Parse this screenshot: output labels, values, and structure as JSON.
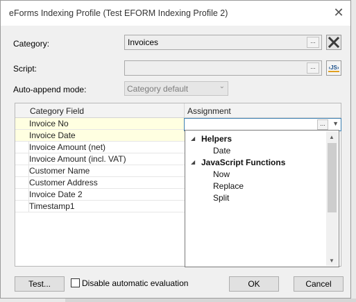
{
  "window": {
    "title": "eForms Indexing Profile (Test EFORM Indexing Profile 2)"
  },
  "form": {
    "category_label": "Category:",
    "category_value": "Invoices",
    "script_label": "Script:",
    "script_value": "",
    "ellipsis": "...",
    "js_icon_text": "‹JS›",
    "auto_append_label": "Auto-append mode:",
    "auto_append_value": "Category default"
  },
  "grid": {
    "columns": [
      "Category Field",
      "Assignment"
    ],
    "rows": [
      "Invoice No",
      "Invoice Date",
      "Invoice Amount (net)",
      "Invoice Amount (incl. VAT)",
      "Customer Name",
      "Customer Address",
      "Invoice Date 2",
      "Timestamp1"
    ],
    "highlighted_rows": [
      0,
      1
    ]
  },
  "popup": {
    "groups": [
      {
        "label": "Helpers",
        "items": [
          "Date"
        ]
      },
      {
        "label": "JavaScript Functions",
        "items": [
          "Now",
          "Replace",
          "Split"
        ]
      }
    ]
  },
  "footer": {
    "test_label": "Test...",
    "disable_eval_label": "Disable automatic evaluation",
    "ok_label": "OK",
    "cancel_label": "Cancel"
  },
  "colors": {
    "highlight_row": "#ffffe1",
    "focus_border": "#3c7fb1"
  }
}
